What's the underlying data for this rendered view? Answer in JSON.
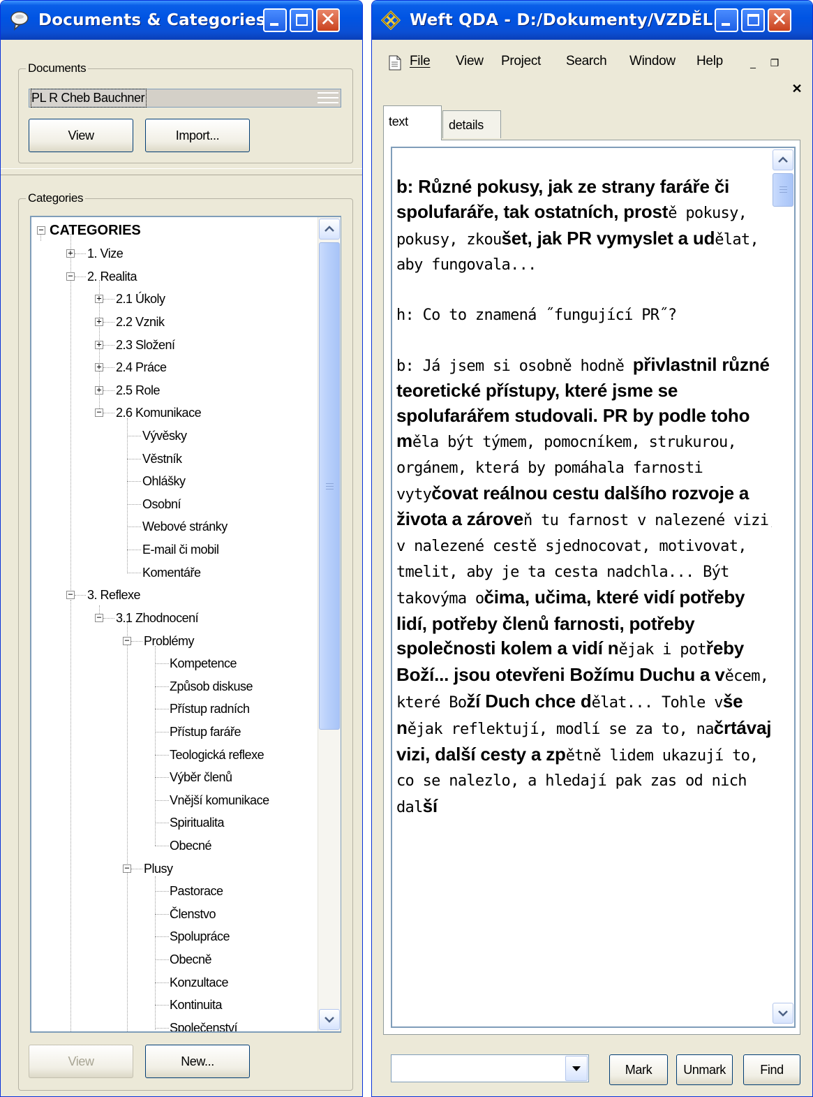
{
  "left_window": {
    "title": "Documents & Categories",
    "documents_group_label": "Documents",
    "selected_document": "PL R Cheb Bauchner",
    "view_button": "View",
    "import_button": "Import...",
    "categories_group_label": "Categories",
    "categories_view_button": "View",
    "categories_new_button": "New...",
    "tree": {
      "root": "CATEGORIES",
      "n1": "1. Vize",
      "n2": "2. Realita",
      "n21": "2.1 Úkoly",
      "n22": "2.2 Vznik",
      "n23": "2.3 Složení",
      "n24": "2.4 Práce",
      "n25": "2.5 Role",
      "n26": "2.6 Komunikace",
      "n261": "Vývěsky",
      "n262": "Věstník",
      "n263": "Ohlášky",
      "n264": "Osobní",
      "n265": "Webové stránky",
      "n266": "E-mail či mobil",
      "n267": "Komentáře",
      "n3": "3. Reflexe",
      "n31": "3.1 Zhodnocení",
      "problemy": "Problémy",
      "p1": "Kompetence",
      "p2": "Způsob diskuse",
      "p3": "Přístup radních",
      "p4": "Přístup faráře",
      "p5": "Teologická reflexe",
      "p6": "Výběr členů",
      "p7": "Vnější komunikace",
      "p8": "Spiritualita",
      "p9": "Obecné",
      "plusy": "Plusy",
      "q1": "Pastorace",
      "q2": "Členstvo",
      "q3": "Spolupráce",
      "q4": "Obecně",
      "q5": "Konzultace",
      "q6": "Kontinuita",
      "q7": "Společenství"
    }
  },
  "right_window": {
    "title": "Weft QDA - D:/Dokumenty/VZDĚL...",
    "menu": {
      "file": "File",
      "view": "View",
      "project": "Project",
      "search": "Search",
      "window": "Window",
      "help": "Help"
    },
    "tabs": {
      "text": "text",
      "details": "details"
    },
    "document_text": {
      "p1": [
        {
          "t": "b: Různé pokusy, jak ze strany faráře či spolufaráře, tak ostatních, prost",
          "s": "b"
        },
        {
          "t": "ě pokusy, pokusy, zkou",
          "s": "m"
        },
        {
          "t": "šet, jak PR vymyslet a ud",
          "s": "b"
        },
        {
          "t": "ělat, aby fungovala...",
          "s": "m"
        }
      ],
      "p2": [
        {
          "t": "h: Co to znamená ˝fungující PR˝?",
          "s": "m"
        }
      ],
      "p3": [
        {
          "t": "b: Já jsem si osobně hodně ",
          "s": "m"
        },
        {
          "t": "přivlastnil různé teoretické přístupy, které jsme se spolufarářem studovali. PR by podle toho m",
          "s": "b"
        },
        {
          "t": "ěla být týmem, pomocníkem, strukurou, orgánem, která by pomáhala farnosti vyty",
          "s": "m"
        },
        {
          "t": "čovat reálnou cestu dalšího rozvoje a života a zárove",
          "s": "b"
        },
        {
          "t": "ň tu farnost v nalezené vizi, v nalezené cestě sjednocovat, motivovat, tmelit, aby je ta cesta nadchla... Být takovýma o",
          "s": "m"
        },
        {
          "t": "čima, učima, které vidí potřeby lidí, potřeby členů farnosti, potřeby společnosti kolem a vidí n",
          "s": "b"
        },
        {
          "t": "ějak i pot",
          "s": "m"
        },
        {
          "t": "řeby Boží... jsou otevřeni Božímu Duchu a v",
          "s": "b"
        },
        {
          "t": "ěcem, které Bo",
          "s": "m"
        },
        {
          "t": "ží Duch chce d",
          "s": "b"
        },
        {
          "t": "ělat... Tohle v",
          "s": "m"
        },
        {
          "t": "še n",
          "s": "b"
        },
        {
          "t": "ějak reflektují, modlí se za to, na",
          "s": "m"
        },
        {
          "t": "črtávají vizi, další cesty a zp",
          "s": "b"
        },
        {
          "t": "ětně lidem ukazují to, co se nalezlo, a hledají pak zas od nich dal",
          "s": "m"
        },
        {
          "t": "ší",
          "s": "b"
        }
      ]
    },
    "combo_value": "",
    "mark_button": "Mark",
    "unmark_button": "Unmark",
    "find_button": "Find"
  }
}
